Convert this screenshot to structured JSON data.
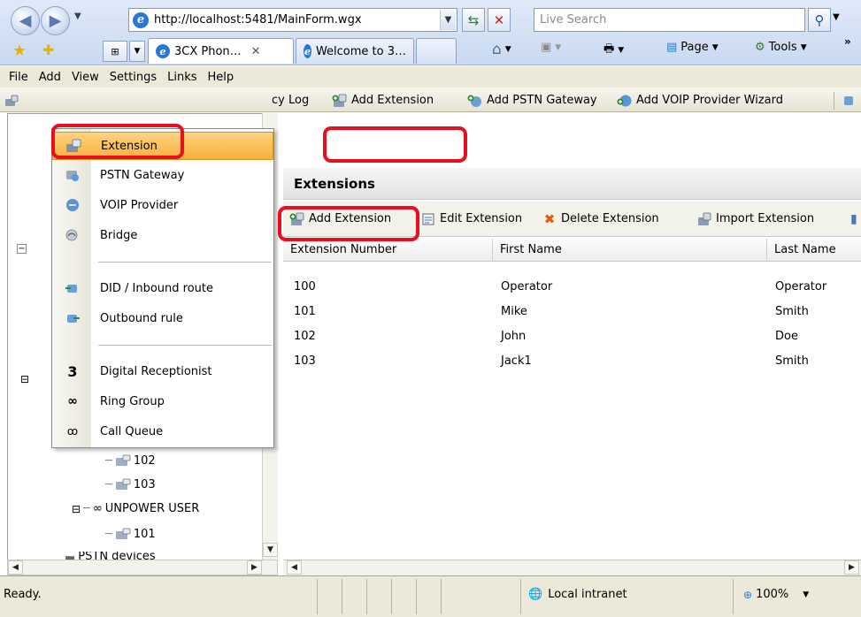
{
  "browser": {
    "address": "http://localhost:5481/MainForm.wgx",
    "search_placeholder": "Live Search",
    "tabs": [
      {
        "label": "3CX Phon…",
        "active": true
      },
      {
        "label": "Welcome to 3…",
        "active": false
      }
    ],
    "commands": {
      "page": "Page",
      "tools": "Tools"
    }
  },
  "menubar": [
    "File",
    "Add",
    "View",
    "Settings",
    "Links",
    "Help"
  ],
  "toolbar": {
    "log": "cy Log",
    "add_extension": "Add Extension",
    "add_pstn": "Add PSTN Gateway",
    "add_voip_wizard": "Add VOIP Provider Wizard"
  },
  "add_menu": {
    "items": [
      {
        "label": "Extension",
        "icon": "extension-icon",
        "highlighted": true
      },
      {
        "label": "PSTN Gateway",
        "icon": "pstn-gateway-icon"
      },
      {
        "label": "VOIP Provider",
        "icon": "voip-provider-icon"
      },
      {
        "label": "Bridge",
        "icon": "bridge-icon"
      },
      {
        "label": "DID / Inbound route",
        "icon": "inbound-route-icon"
      },
      {
        "label": "Outbound rule",
        "icon": "outbound-rule-icon"
      },
      {
        "label": "Digital Receptionist",
        "icon": "receptionist-icon"
      },
      {
        "label": "Ring Group",
        "icon": "ring-group-icon"
      },
      {
        "label": "Call Queue",
        "icon": "call-queue-icon"
      }
    ]
  },
  "tree": {
    "ext_102": "102",
    "ext_103": "103",
    "group": "UNPOWER USER",
    "ext_101": "101",
    "pstn_devices": "PSTN devices"
  },
  "extensions": {
    "title": "Extensions",
    "actions": {
      "add": "Add Extension",
      "edit": "Edit Extension",
      "delete": "Delete Extension",
      "import": "Import Extension"
    },
    "columns": [
      "Extension Number",
      "First Name",
      "Last Name"
    ],
    "rows": [
      {
        "number": "100",
        "first": "Operator",
        "last": "Operator"
      },
      {
        "number": "101",
        "first": "Mike",
        "last": "Smith"
      },
      {
        "number": "102",
        "first": "John",
        "last": "Doe"
      },
      {
        "number": "103",
        "first": "Jack1",
        "last": "Smith"
      }
    ]
  },
  "status": {
    "text": "Ready.",
    "zone": "Local intranet",
    "zoom": "100%"
  },
  "colors": {
    "highlight": "#f6b03b",
    "callout_red": "#e8101e"
  }
}
